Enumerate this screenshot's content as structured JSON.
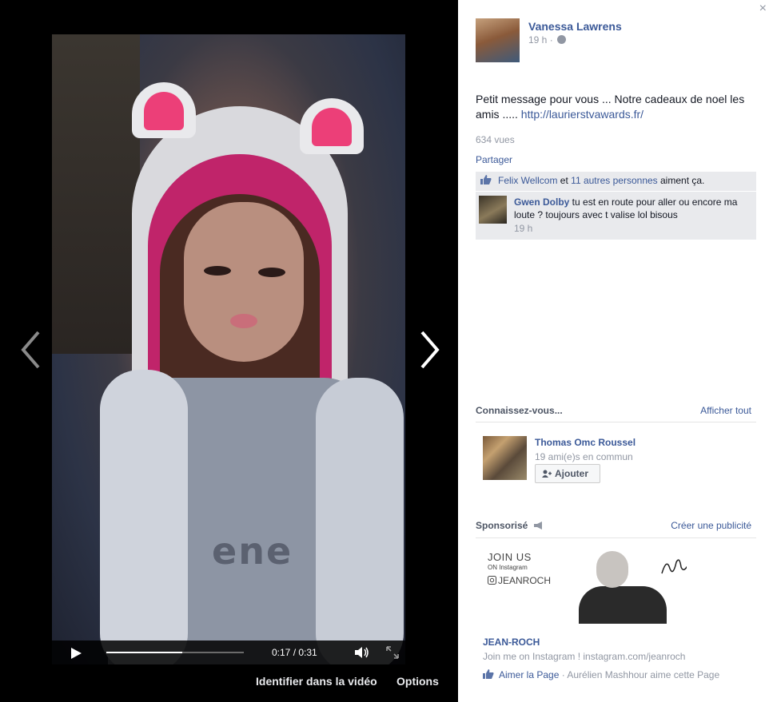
{
  "stage": {
    "time": "0:17 / 0:31",
    "progress": 0.55,
    "shirt_text": "ene",
    "tag_link": "Identifier dans la vidéo",
    "options_link": "Options"
  },
  "panel": {
    "close": "×",
    "author": "Vanessa Lawrens",
    "post_time": "19 h ·",
    "message": "Petit message pour vous ... Notre cadeaux de noel les amis ..... ",
    "message_link": "http://laurierstvawards.fr/",
    "views": "634 vues",
    "share": "Partager",
    "likes": {
      "name": "Felix Wellcom",
      "and": " et ",
      "others": "11 autres personnes",
      "suffix": " aiment ça."
    },
    "comment": {
      "author": "Gwen Dolby",
      "text": " tu est en route pour aller ou encore ma loute ? toujours avec t valise lol bisous",
      "time": "19 h"
    },
    "pymk": {
      "header": "Connaissez-vous...",
      "see_all": "Afficher tout",
      "name": "Thomas Omc Roussel",
      "mutual": "19 ami(e)s en commun",
      "add_label": "Ajouter"
    },
    "sponsored": {
      "header": "Sponsorisé",
      "create_ad": "Créer une publicité",
      "img_line1": "JOIN US",
      "img_line2": "ON Instagram",
      "img_line3": "JEANROCH",
      "name": "JEAN-ROCH",
      "desc": "Join me on Instagram ! instagram.com/jeanroch",
      "like_link": "Aimer la Page",
      "like_text": " · Aurélien Mashhour aime cette Page"
    }
  }
}
